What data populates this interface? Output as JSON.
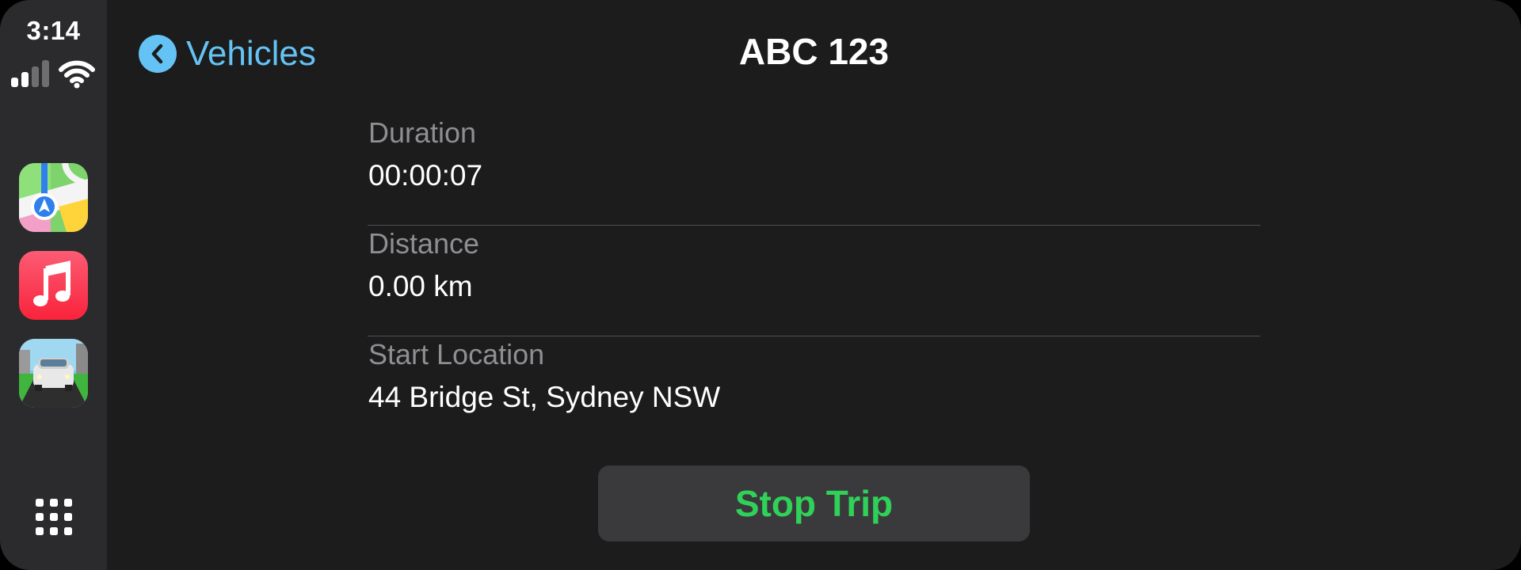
{
  "status_bar": {
    "time": "3:14"
  },
  "sidebar": {
    "apps": [
      {
        "name": "Maps",
        "icon": "maps-app-icon"
      },
      {
        "name": "Music",
        "icon": "music-app-icon"
      },
      {
        "name": "Vehicle",
        "icon": "car-app-icon"
      }
    ],
    "home_icon": "app-grid-icon"
  },
  "nav": {
    "back_label": "Vehicles",
    "title": "ABC 123"
  },
  "details": [
    {
      "label": "Duration",
      "value": "00:00:07"
    },
    {
      "label": "Distance",
      "value": "0.00 km"
    },
    {
      "label": "Start Location",
      "value": "44 Bridge St, Sydney NSW"
    }
  ],
  "actions": {
    "stop_trip_label": "Stop Trip"
  },
  "colors": {
    "accent_blue": "#64c2f4",
    "stop_green": "#30d158",
    "background": "#1c1c1c",
    "sidebar": "#2b2b2d",
    "button_bg": "#3a3a3c"
  }
}
